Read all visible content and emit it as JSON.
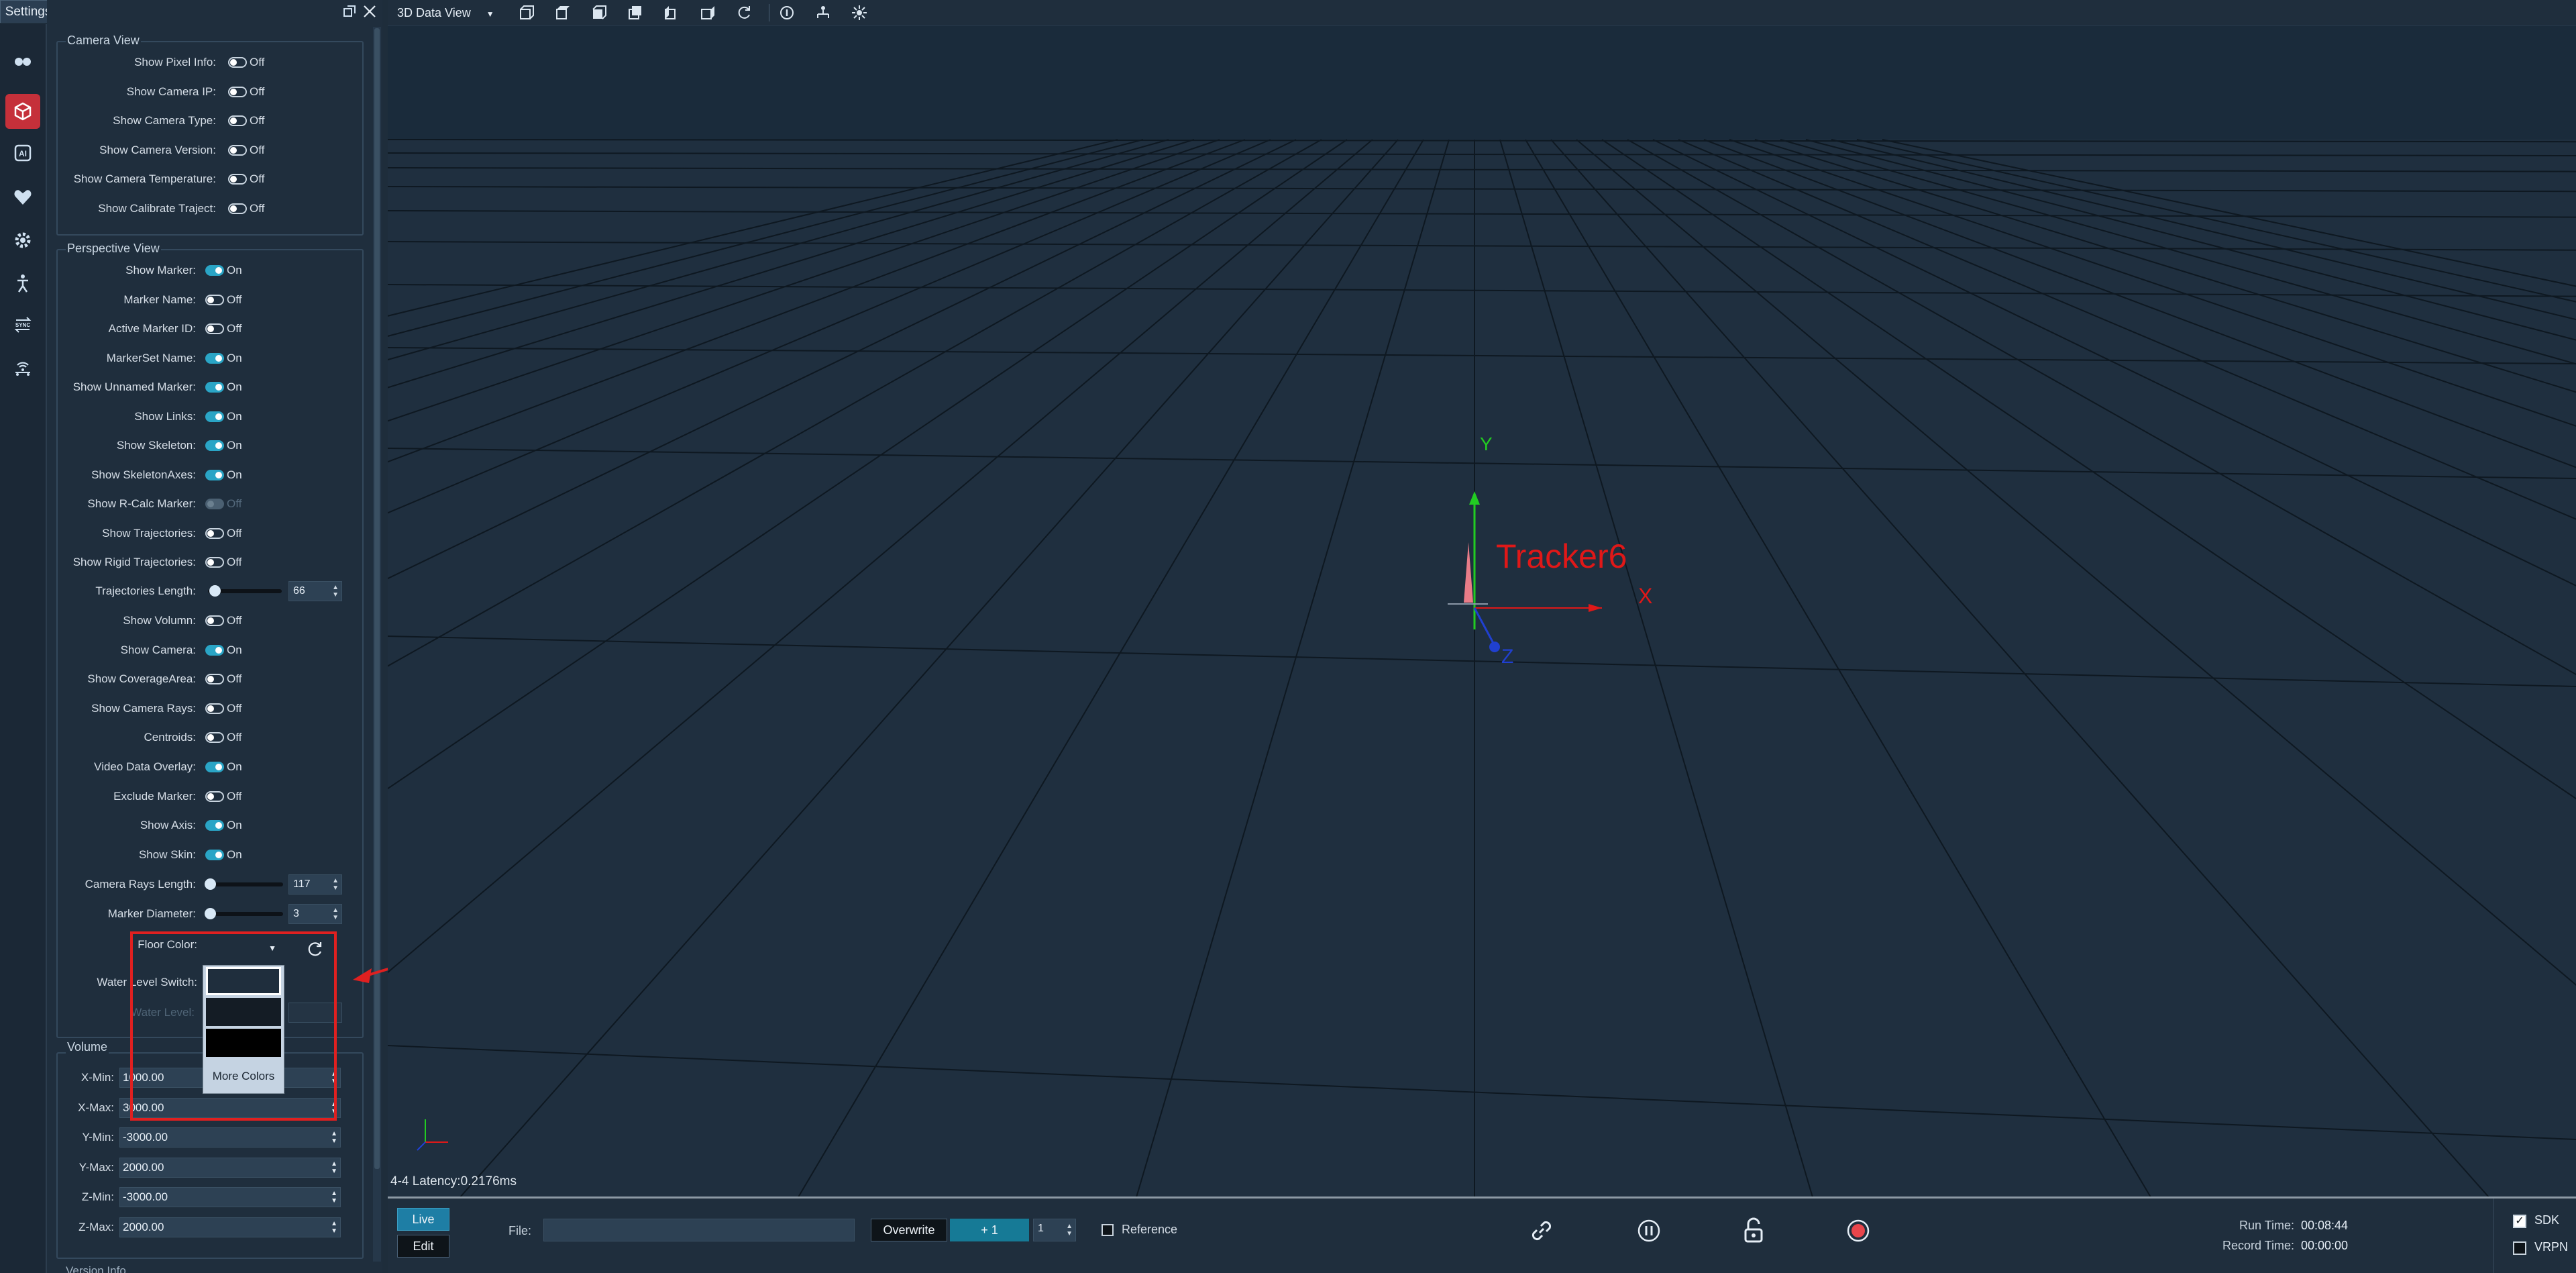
{
  "panel": {
    "tab_title": "Settings"
  },
  "camera_view": {
    "title": "Camera View",
    "items": [
      {
        "label": "Show Pixel Info:",
        "state": "Off"
      },
      {
        "label": "Show Camera IP:",
        "state": "Off"
      },
      {
        "label": "Show Camera Type:",
        "state": "Off"
      },
      {
        "label": "Show Camera Version:",
        "state": "Off"
      },
      {
        "label": "Show Camera Temperature:",
        "state": "Off"
      },
      {
        "label": "Show Calibrate Traject:",
        "state": "Off"
      }
    ]
  },
  "perspective_view": {
    "title": "Perspective View",
    "items": [
      {
        "label": "Show Marker:",
        "state": "On"
      },
      {
        "label": "Marker Name:",
        "state": "Off"
      },
      {
        "label": "Active Marker ID:",
        "state": "Off"
      },
      {
        "label": "MarkerSet Name:",
        "state": "On"
      },
      {
        "label": "Show Unnamed Marker:",
        "state": "On"
      },
      {
        "label": "Show Links:",
        "state": "On"
      },
      {
        "label": "Show Skeleton:",
        "state": "On"
      },
      {
        "label": "Show SkeletonAxes:",
        "state": "On"
      },
      {
        "label": "Show R-Calc Marker:",
        "state": "Off",
        "disabled": true
      },
      {
        "label": "Show Trajectories:",
        "state": "Off"
      },
      {
        "label": "Show Rigid Trajectories:",
        "state": "Off"
      }
    ],
    "traj_length": {
      "label": "Trajectories Length:",
      "value": "66",
      "fraction": 0.05
    },
    "items2": [
      {
        "label": "Show Volumn:",
        "state": "Off"
      },
      {
        "label": "Show Camera:",
        "state": "On"
      },
      {
        "label": "Show CoverageArea:",
        "state": "Off"
      },
      {
        "label": "Show Camera Rays:",
        "state": "Off"
      },
      {
        "label": "Centroids:",
        "state": "Off"
      },
      {
        "label": "Video Data Overlay:",
        "state": "On"
      },
      {
        "label": "Exclude Marker:",
        "state": "Off"
      },
      {
        "label": "Show Axis:",
        "state": "On"
      },
      {
        "label": "Show Skin:",
        "state": "On"
      }
    ],
    "rays_length": {
      "label": "Camera Rays Length:",
      "value": "117",
      "fraction": 0.02
    },
    "marker_diameter": {
      "label": "Marker Diameter:",
      "value": "3",
      "fraction": 0.02
    },
    "floor_color": {
      "label": "Floor Color:"
    },
    "water_switch": {
      "label": "Water Level Switch:"
    },
    "water_level": {
      "label": "Water Level:"
    }
  },
  "popup": {
    "more_colors": "More Colors",
    "swatches": [
      "#1f2e3d",
      "#141c25",
      "#000000"
    ]
  },
  "volume": {
    "title": "Volume",
    "rows": [
      {
        "label": "X-Min:",
        "value": "1000.00"
      },
      {
        "label": "X-Max:",
        "value": "3000.00"
      },
      {
        "label": "Y-Min:",
        "value": "-3000.00"
      },
      {
        "label": "Y-Max:",
        "value": "2000.00"
      },
      {
        "label": "Z-Min:",
        "value": "-3000.00"
      },
      {
        "label": "Z-Max:",
        "value": "2000.00"
      }
    ],
    "next_section": "Version Info"
  },
  "toolbar": {
    "view_select": "3D Data View"
  },
  "viewport": {
    "tracker_label": "Tracker6",
    "axis_y": "Y",
    "axis_x": "X",
    "axis_z": "Z",
    "latency": "4-4 Latency:0.2176ms"
  },
  "bottom": {
    "live": "Live",
    "edit": "Edit",
    "file_label": "File:",
    "file_value": "",
    "overwrite": "Overwrite",
    "counter": "+ 1",
    "spin_value": "1",
    "reference": "Reference",
    "run_time_label": "Run Time:",
    "run_time": "00:08:44",
    "record_time_label": "Record Time:",
    "record_time": "00:00:00",
    "sdk": "SDK",
    "vrpn": "VRPN"
  },
  "colors": {
    "accent": "#2aa5c6",
    "active_icon_bg": "#c5303a",
    "annotation": "#e02020"
  }
}
